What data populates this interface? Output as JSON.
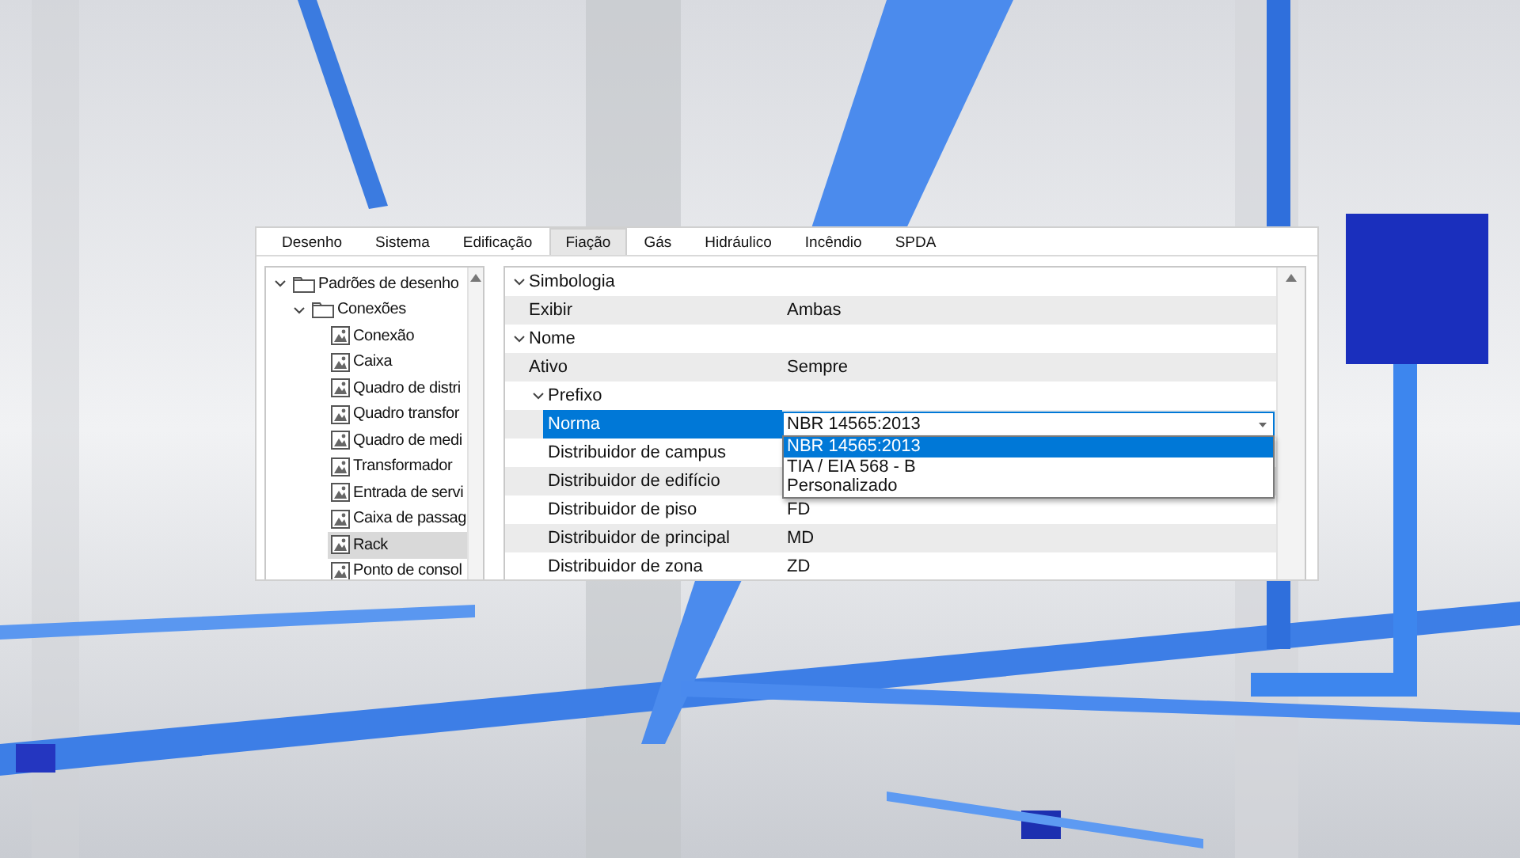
{
  "tabs": [
    {
      "label": "Desenho",
      "selected": false
    },
    {
      "label": "Sistema",
      "selected": false
    },
    {
      "label": "Edificação",
      "selected": false
    },
    {
      "label": "Fiação",
      "selected": true
    },
    {
      "label": "Gás",
      "selected": false
    },
    {
      "label": "Hidráulico",
      "selected": false
    },
    {
      "label": "Incêndio",
      "selected": false
    },
    {
      "label": "SPDA",
      "selected": false
    }
  ],
  "tree": [
    {
      "kind": "folder",
      "label": "Padrões de desenho",
      "expanded": true,
      "children": [
        {
          "kind": "folder",
          "label": "Conexões",
          "expanded": true,
          "children": [
            {
              "kind": "item",
              "label": "Conexão",
              "selected": false
            },
            {
              "kind": "item",
              "label": "Caixa",
              "selected": false
            },
            {
              "kind": "item",
              "label": "Quadro de distri",
              "selected": false
            },
            {
              "kind": "item",
              "label": "Quadro transfor",
              "selected": false
            },
            {
              "kind": "item",
              "label": "Quadro de medi",
              "selected": false
            },
            {
              "kind": "item",
              "label": "Transformador",
              "selected": false
            },
            {
              "kind": "item",
              "label": "Entrada de servi",
              "selected": false
            },
            {
              "kind": "item",
              "label": "Caixa de passag",
              "selected": false
            },
            {
              "kind": "item",
              "label": "Rack",
              "selected": true
            },
            {
              "kind": "item",
              "label": "Ponto de consol",
              "selected": false
            }
          ]
        }
      ]
    }
  ],
  "property_grid": [
    {
      "kind": "category",
      "label": "Simbologia",
      "expanded": true,
      "children": [
        {
          "kind": "property",
          "label": "Exibir",
          "value": "Ambas",
          "selected": false
        }
      ]
    },
    {
      "kind": "category",
      "label": "Nome",
      "expanded": true,
      "children": [
        {
          "kind": "property",
          "label": "Ativo",
          "value": "Sempre",
          "selected": false
        },
        {
          "kind": "category",
          "label": "Prefixo",
          "expanded": true,
          "children": [
            {
              "kind": "property",
              "label": "Norma",
              "value": "NBR 14565:2013",
              "selected": true,
              "dropdown": [
                {
                  "label": "NBR 14565:2013",
                  "selected": true
                },
                {
                  "label": "TIA / EIA 568 - B",
                  "selected": false
                },
                {
                  "label": "Personalizado",
                  "selected": false
                }
              ]
            },
            {
              "kind": "property",
              "label": "Distribuidor de campus",
              "selected": false
            },
            {
              "kind": "property",
              "label": "Distribuidor de edifício",
              "selected": false
            },
            {
              "kind": "property",
              "label": "Distribuidor de piso",
              "value": "FD",
              "selected": false
            },
            {
              "kind": "property",
              "label": "Distribuidor de principal",
              "value": "MD",
              "selected": false
            },
            {
              "kind": "property",
              "label": "Distribuidor de zona",
              "value": "ZD",
              "selected": false
            }
          ]
        }
      ]
    }
  ]
}
